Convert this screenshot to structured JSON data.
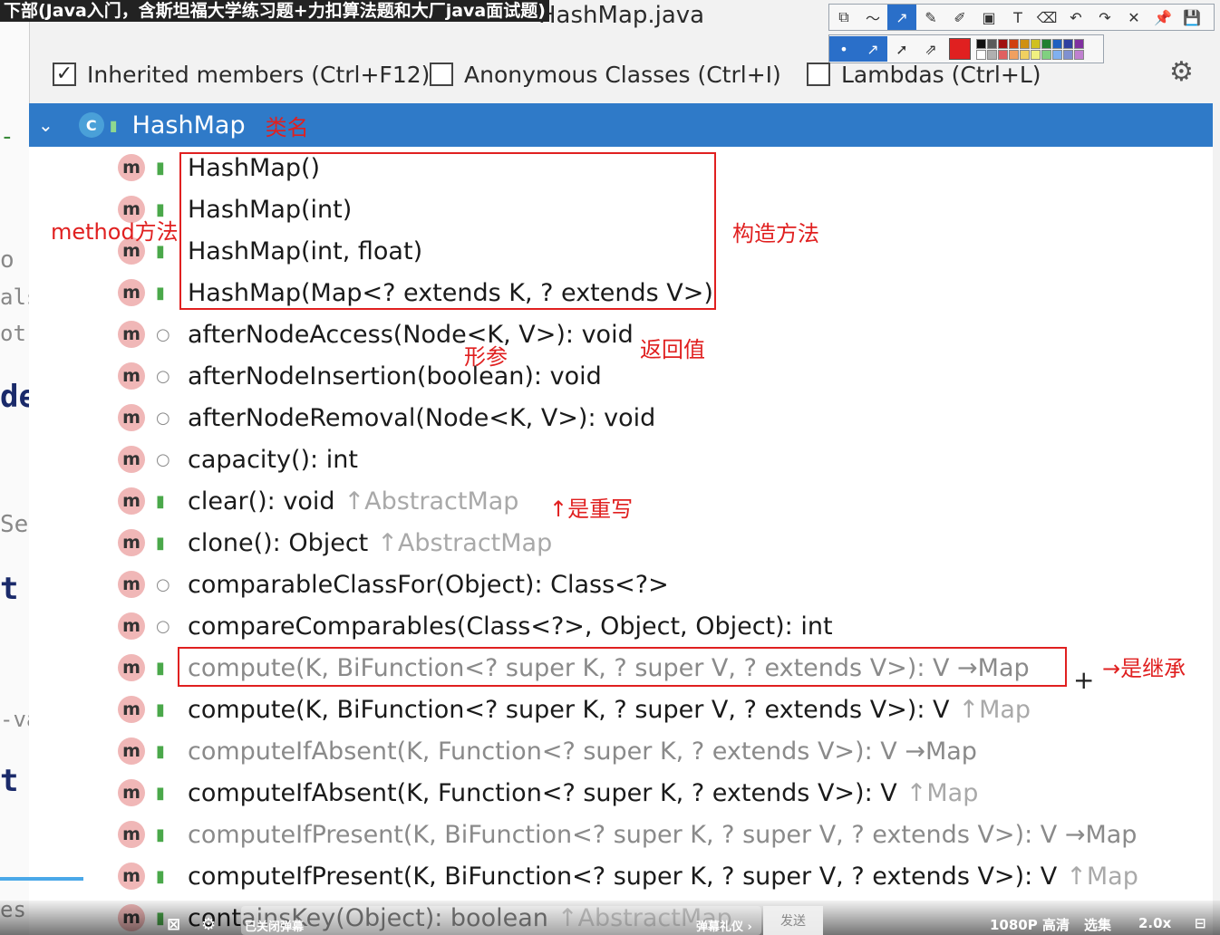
{
  "video_title": "下部(Java入门，含斯坦福大学练习题+力扣算法题和大厂java面试题)",
  "file_title": "HashMap.java",
  "filters": {
    "inherited": {
      "label": "Inherited members (Ctrl+F12)",
      "checked": "✓"
    },
    "anonymous": {
      "label": "Anonymous Classes (Ctrl+I)",
      "checked": ""
    },
    "lambdas": {
      "label": "Lambdas (Ctrl+L)",
      "checked": ""
    }
  },
  "toolbar": {
    "tools": [
      "⧉",
      "〜",
      "↗",
      "✎",
      "✐",
      "▣",
      "T",
      "⌫",
      "↶",
      "↷",
      "✕",
      "📌",
      "💾"
    ],
    "row2": [
      "•",
      "↗",
      "➚",
      "⇗"
    ]
  },
  "colors": {
    "selection_blue": "#2f7ac8",
    "annotation_red": "#e02020",
    "method_icon": "#f0b7b7",
    "public_green": "#4aa84a",
    "swatches": [
      "#111111",
      "#5a5a5a",
      "#a01010",
      "#d04010",
      "#d09010",
      "#d0c020",
      "#208030",
      "#2060c0",
      "#3040a0",
      "#8030a0",
      "#ffffff",
      "#b0b0b0",
      "#e06060",
      "#f0a060",
      "#f0d060",
      "#f0f080",
      "#80d080",
      "#80b0f0",
      "#8090d0",
      "#c080d0"
    ]
  },
  "class_row": {
    "name": "HashMap"
  },
  "members": [
    {
      "icon": "m",
      "vis": "pub",
      "sig": "HashMap()",
      "ovr": "",
      "inherited": false
    },
    {
      "icon": "m",
      "vis": "pub",
      "sig": "HashMap(int)",
      "ovr": "",
      "inherited": false
    },
    {
      "icon": "m",
      "vis": "pub",
      "sig": "HashMap(int, float)",
      "ovr": "",
      "inherited": false
    },
    {
      "icon": "m",
      "vis": "pub",
      "sig": "HashMap(Map<? extends K, ? extends V>)",
      "ovr": "",
      "inherited": false
    },
    {
      "icon": "m",
      "vis": "pkg",
      "sig": "afterNodeAccess(Node<K, V>): void",
      "ovr": "",
      "inherited": false
    },
    {
      "icon": "m",
      "vis": "pkg",
      "sig": "afterNodeInsertion(boolean): void",
      "ovr": "",
      "inherited": false
    },
    {
      "icon": "m",
      "vis": "pkg",
      "sig": "afterNodeRemoval(Node<K, V>): void",
      "ovr": "",
      "inherited": false
    },
    {
      "icon": "m",
      "vis": "pkg",
      "sig": "capacity(): int",
      "ovr": "",
      "inherited": false
    },
    {
      "icon": "m",
      "vis": "pub",
      "sig": "clear(): void",
      "ovr": "↑AbstractMap",
      "inherited": false
    },
    {
      "icon": "m",
      "vis": "pub",
      "sig": "clone(): Object",
      "ovr": "↑AbstractMap",
      "inherited": false
    },
    {
      "icon": "m",
      "vis": "pkg",
      "sig": "comparableClassFor(Object): Class<?>",
      "ovr": "",
      "inherited": false
    },
    {
      "icon": "m",
      "vis": "pkg",
      "sig": "compareComparables(Class<?>, Object, Object): int",
      "ovr": "",
      "inherited": false
    },
    {
      "icon": "m",
      "vis": "pub",
      "sig": "compute(K, BiFunction<? super K, ? super V, ? extends V>): V →Map",
      "ovr": "",
      "inherited": true
    },
    {
      "icon": "m",
      "vis": "pub",
      "sig": "compute(K, BiFunction<? super K, ? super V, ? extends V>): V",
      "ovr": "↑Map",
      "inherited": false
    },
    {
      "icon": "m",
      "vis": "pub",
      "sig": "computeIfAbsent(K, Function<? super K, ? extends V>): V →Map",
      "ovr": "",
      "inherited": true
    },
    {
      "icon": "m",
      "vis": "pub",
      "sig": "computeIfAbsent(K, Function<? super K, ? extends V>): V",
      "ovr": "↑Map",
      "inherited": false
    },
    {
      "icon": "m",
      "vis": "pub",
      "sig": "computeIfPresent(K, BiFunction<? super K, ? super V, ? extends V>): V →Map",
      "ovr": "",
      "inherited": true
    },
    {
      "icon": "m",
      "vis": "pub",
      "sig": "computeIfPresent(K, BiFunction<? super K, ? super V, ? extends V>): V",
      "ovr": "↑Map",
      "inherited": false
    },
    {
      "icon": "m",
      "vis": "pub",
      "sig": "containsKey(Object): boolean",
      "ovr": "↑AbstractMap",
      "inherited": false
    }
  ],
  "annotations": {
    "class_name": "类名",
    "method": "method方法",
    "constructor": "构造方法",
    "return_value": "返回值",
    "param": "形参",
    "override": "↑是重写",
    "inherit": "→是继承"
  },
  "left_strip": [
    "o",
    "als",
    "ot",
    "de",
    "Se",
    "t",
    "-va",
    "t",
    "es"
  ],
  "video_bar": {
    "danmaku_placeholder": "已关闭弹幕",
    "gift": "弹幕礼仪 ›",
    "send": "发送",
    "quality": "1080P 高清",
    "episodes": "选集",
    "speed": "2.0x"
  }
}
